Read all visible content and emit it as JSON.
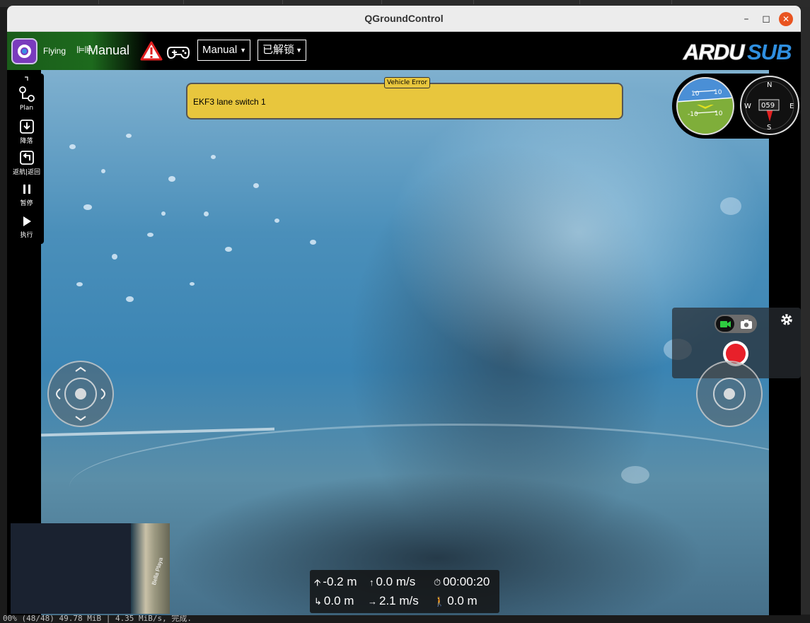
{
  "window": {
    "title": "QGroundControl"
  },
  "toolbar": {
    "status": "Flying",
    "mode_name": "Manual",
    "mode_dropdown": "Manual",
    "arm_dropdown": "已解锁",
    "brand": "ARDUSUB",
    "status_color": "#1d6a1d"
  },
  "toolstrip": {
    "items": [
      {
        "label": "Plan",
        "icon": "plan-icon"
      },
      {
        "label": "降落",
        "icon": "land-icon"
      },
      {
        "label": "返航|返回",
        "icon": "return-icon"
      },
      {
        "label": "暂停",
        "icon": "pause-icon"
      },
      {
        "label": "执行",
        "icon": "play-icon"
      }
    ]
  },
  "vehicle_error": {
    "tag": "Vehicle Error",
    "message": "EKF3 lane switch 1",
    "color": "#e8c63d"
  },
  "instruments": {
    "attitude_ticks": [
      "10",
      "10",
      "-10",
      "10"
    ],
    "compass_heading": "059",
    "compass_labels": [
      "N",
      "E",
      "S",
      "W"
    ]
  },
  "camera": {
    "record_color": "#e8202a"
  },
  "map": {
    "place": "Bella Playa"
  },
  "telemetry": {
    "altitude": "-0.2 m",
    "vertical_speed": "0.0 m/s",
    "flight_time": "00:00:20",
    "distance_home": "0.0 m",
    "ground_speed": "2.1 m/s",
    "distance_other": "0.0 m"
  },
  "bottom_text": "00% (48/48)  49.78 MiB | 4.35 MiB/s, 完成."
}
